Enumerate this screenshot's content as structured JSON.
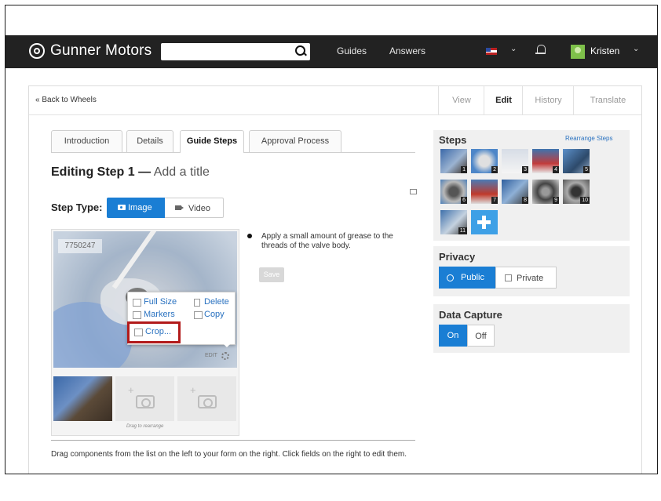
{
  "header": {
    "brand": "Gunner Motors",
    "search": {
      "placeholder": "",
      "value": ""
    },
    "nav": [
      "Guides",
      "Answers"
    ],
    "user": "Kristen"
  },
  "breadcrumb": {
    "back": "« Back to Wheels"
  },
  "mode_tabs": [
    "View",
    "Edit",
    "History",
    "Translate"
  ],
  "active_mode": "Edit",
  "editor_tabs": [
    "Introduction",
    "Details",
    "Guide Steps",
    "Approval Process"
  ],
  "active_editor_tab": "Guide Steps",
  "step": {
    "heading_prefix": "Editing Step 1 —",
    "title_placeholder": "Add a title",
    "type_label": "Step Type:",
    "type_options": [
      "Image",
      "Video"
    ],
    "selected_type": "Image",
    "image_id": "7750247",
    "edit_label": "EDIT",
    "bullet": "Apply a small amount of grease to the threads of the valve body.",
    "save_label": "Save",
    "drag_label": "Drag to rearrange"
  },
  "image_menu": {
    "full_size": "Full Size",
    "delete": "Delete",
    "markers": "Markers",
    "copy": "Copy",
    "crop": "Crop..."
  },
  "help_text": "Drag components from the list on the left to your form on the right. Click fields on the right to edit them.",
  "steps_panel": {
    "title": "Steps",
    "rearrange": "Rearrange Steps",
    "numbers": [
      "1",
      "2",
      "3",
      "4",
      "5",
      "6",
      "7",
      "8",
      "9",
      "10",
      "11"
    ]
  },
  "privacy": {
    "title": "Privacy",
    "public": "Public",
    "private": "Private",
    "selected": "Public"
  },
  "data_capture": {
    "title": "Data Capture",
    "on": "On",
    "off": "Off",
    "selected": "On"
  },
  "colors": {
    "accent": "#1a7ed4",
    "topbar": "#222222",
    "highlight": "#b21a1a"
  }
}
